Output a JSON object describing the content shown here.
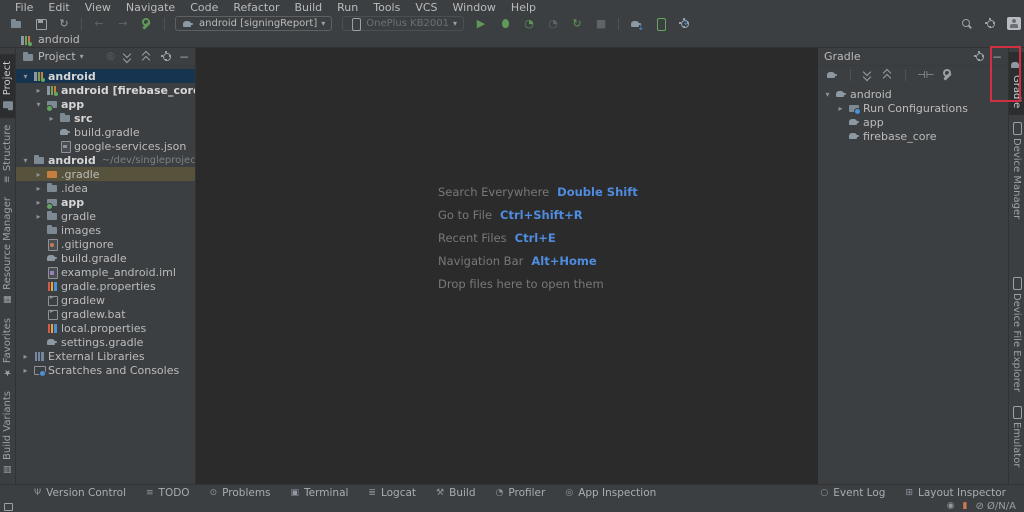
{
  "menu_bar": {
    "items": [
      "File",
      "Edit",
      "View",
      "Navigate",
      "Code",
      "Refactor",
      "Build",
      "Run",
      "Tools",
      "VCS",
      "Window",
      "Help"
    ]
  },
  "toolbar": {
    "run_config": "android [signingReport]",
    "device": "OnePlus KB2001",
    "icon_names": [
      "open-project",
      "save-all",
      "synchronize",
      "back",
      "forward",
      "project-structure",
      "run",
      "debug",
      "profile",
      "apply-changes",
      "apply-code-changes",
      "stop",
      "sync-gradle",
      "device-manager",
      "sdk-manager",
      "search-everywhere",
      "settings",
      "avatar"
    ]
  },
  "navbar": {
    "breadcrumb": "android"
  },
  "left_strip": {
    "top": [
      {
        "label": "Project",
        "icon": "folder",
        "active": true
      },
      {
        "label": "Structure",
        "icon": "structure",
        "active": false
      },
      {
        "label": "Resource Manager",
        "icon": "resource-manager",
        "active": false
      }
    ],
    "bottom": [
      {
        "label": "Favorites",
        "icon": "star",
        "active": false
      },
      {
        "label": "Build Variants",
        "icon": "build-variants",
        "active": false
      }
    ]
  },
  "project_panel": {
    "title": "Project",
    "tree": [
      {
        "label": "android",
        "level": 0,
        "chevron": "expanded",
        "icon": "module-android",
        "bold": true,
        "selected": "focus"
      },
      {
        "label": "android [firebase_core]",
        "level": 1,
        "chevron": "collapsed",
        "icon": "module-android",
        "bold": true
      },
      {
        "label": "app",
        "level": 1,
        "chevron": "expanded",
        "icon": "folder-app",
        "bold": true
      },
      {
        "label": "src",
        "level": 2,
        "chevron": "collapsed",
        "icon": "folder",
        "bold": true
      },
      {
        "label": "build.gradle",
        "level": 2,
        "icon": "gradle"
      },
      {
        "label": "google-services.json",
        "level": 2,
        "icon": "file-json"
      },
      {
        "label": "android",
        "suffix": "~/dev/singleproject/examp",
        "level": 0,
        "chevron": "expanded",
        "icon": "folder",
        "bold": true
      },
      {
        "label": ".gradle",
        "level": 1,
        "chevron": "collapsed",
        "icon": "folder-excluded",
        "selected": "drop"
      },
      {
        "label": ".idea",
        "level": 1,
        "chevron": "collapsed",
        "icon": "folder"
      },
      {
        "label": "app",
        "level": 1,
        "chevron": "collapsed",
        "icon": "folder-app",
        "bold": true
      },
      {
        "label": "gradle",
        "level": 1,
        "chevron": "collapsed",
        "icon": "folder"
      },
      {
        "label": "images",
        "level": 1,
        "icon": "folder"
      },
      {
        "label": ".gitignore",
        "level": 1,
        "icon": "file-git"
      },
      {
        "label": "build.gradle",
        "level": 1,
        "icon": "gradle"
      },
      {
        "label": "example_android.iml",
        "level": 1,
        "icon": "file-iml"
      },
      {
        "label": "gradle.properties",
        "level": 1,
        "icon": "file-properties"
      },
      {
        "label": "gradlew",
        "level": 1,
        "icon": "file-exec"
      },
      {
        "label": "gradlew.bat",
        "level": 1,
        "icon": "file-exec"
      },
      {
        "label": "local.properties",
        "level": 1,
        "icon": "file-properties"
      },
      {
        "label": "settings.gradle",
        "level": 1,
        "icon": "gradle"
      },
      {
        "label": "External Libraries",
        "level": 0,
        "chevron": "collapsed",
        "icon": "libraries"
      },
      {
        "label": "Scratches and Consoles",
        "level": 0,
        "chevron": "collapsed",
        "icon": "scratches"
      }
    ]
  },
  "editor": {
    "shortcuts": [
      {
        "label": "Search Everywhere",
        "keys": "Double Shift"
      },
      {
        "label": "Go to File",
        "keys": "Ctrl+Shift+R"
      },
      {
        "label": "Recent Files",
        "keys": "Ctrl+E"
      },
      {
        "label": "Navigation Bar",
        "keys": "Alt+Home"
      },
      {
        "label": "Drop files here to open them",
        "keys": ""
      }
    ]
  },
  "gradle_panel": {
    "title": "Gradle",
    "tree": [
      {
        "label": "android",
        "level": 0,
        "chevron": "expanded",
        "icon": "gradle"
      },
      {
        "label": "Run Configurations",
        "level": 1,
        "chevron": "collapsed",
        "icon": "folder-run"
      },
      {
        "label": "app",
        "level": 1,
        "icon": "gradle"
      },
      {
        "label": "firebase_core",
        "level": 1,
        "icon": "gradle"
      }
    ]
  },
  "right_strip": {
    "top": [
      {
        "label": "Gradle",
        "icon": "gradle",
        "active": true
      },
      {
        "label": "Device Manager",
        "icon": "phone",
        "active": false
      }
    ],
    "bottom": [
      {
        "label": "Device File Explorer",
        "icon": "phone",
        "active": false
      },
      {
        "label": "Emulator",
        "icon": "phone",
        "active": false
      }
    ]
  },
  "bottom_bar": {
    "left": [
      {
        "label": "Version Control",
        "icon": "vcs"
      },
      {
        "label": "TODO",
        "icon": "todo"
      },
      {
        "label": "Problems",
        "icon": "problems"
      },
      {
        "label": "Terminal",
        "icon": "terminal"
      },
      {
        "label": "Logcat",
        "icon": "logcat"
      },
      {
        "label": "Build",
        "icon": "build"
      },
      {
        "label": "Profiler",
        "icon": "profiler"
      },
      {
        "label": "App Inspection",
        "icon": "inspection"
      }
    ],
    "right": [
      {
        "label": "Event Log",
        "icon": "event-log"
      },
      {
        "label": "Layout Inspector",
        "icon": "layout-inspector"
      }
    ]
  },
  "status_bar": {
    "device_stats": "⊘ Ø/N/A"
  },
  "icon_glyphs": {
    "vcs": "Ψ",
    "todo": "≡",
    "problems": "⊙",
    "terminal": "▣",
    "logcat": "≣",
    "build": "⚒",
    "profiler": "◔",
    "inspection": "◎",
    "event-log": "○",
    "layout-inspector": "⊞",
    "eye": "◉",
    "book": "▮",
    "structure": "≡",
    "resource-manager": "▦",
    "star": "★",
    "build-variants": "▥",
    "locate": "◎",
    "sync": "↻",
    "back": "←",
    "forward": "→",
    "run": "▶",
    "stop": "■",
    "gauge": "◔",
    "apply": "↻",
    "caret": "▾",
    "chevron-expanded": "▾",
    "chevron-collapsed": "▸",
    "offline-toggle": "⊣⊢"
  },
  "colors": {
    "panel_bg": "#3c3f41",
    "editor_bg": "#2b2b2b",
    "selection_focus": "#163450",
    "selection_drop": "#57523b",
    "shortcut_blue": "#4f8ce0",
    "annotation_red": "#d32f42",
    "run_green": "#5f9957",
    "border": "#323232"
  }
}
